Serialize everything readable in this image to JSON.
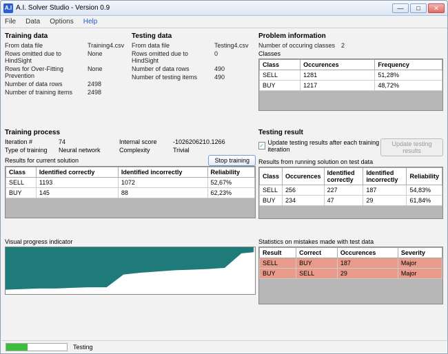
{
  "window": {
    "title": "A.I. Solver Studio - Version 0.9"
  },
  "menu": {
    "file": "File",
    "data": "Data",
    "options": "Options",
    "help": "Help"
  },
  "training_data": {
    "title": "Training data",
    "rows": [
      {
        "k": "From data file",
        "v": "Training4.csv"
      },
      {
        "k": "Rows omitted due to HindSight",
        "v": "None"
      },
      {
        "k": "Rows for Over-Fitting Prevention",
        "v": "None"
      },
      {
        "k": "Number of data rows",
        "v": "2498"
      },
      {
        "k": "Number of training items",
        "v": "2498"
      }
    ]
  },
  "testing_data": {
    "title": "Testing data",
    "rows": [
      {
        "k": "From data file",
        "v": "Testing4.csv"
      },
      {
        "k": "Rows omitted due to HindSight",
        "v": "0"
      },
      {
        "k": "Number of data rows",
        "v": "490"
      },
      {
        "k": "Number of testing items",
        "v": "490"
      }
    ]
  },
  "problem": {
    "title": "Problem information",
    "num_classes_label": "Number of occuring classes",
    "num_classes": "2",
    "classes_label": "Classes",
    "headers": [
      "Class",
      "Occurences",
      "Frequency"
    ],
    "rows": [
      [
        "SELL",
        "1281",
        "51,28%"
      ],
      [
        "BUY",
        "1217",
        "48,72%"
      ]
    ]
  },
  "training_process": {
    "title": "Training process",
    "iteration_label": "Iteration #",
    "iteration": "74",
    "score_label": "Internal score",
    "score": "-1026206210.1266",
    "type_label": "Type of training",
    "type": "Neural network",
    "complexity_label": "Complexity",
    "complexity": "Trivial",
    "results_label": "Results for current solution",
    "stop_btn": "Stop training",
    "headers": [
      "Class",
      "Identified correctly",
      "Identified incorrectly",
      "Reliability"
    ],
    "rows": [
      [
        "SELL",
        "1193",
        "1072",
        "52,67%"
      ],
      [
        "BUY",
        "145",
        "88",
        "62,23%"
      ]
    ]
  },
  "testing_result": {
    "title": "Testing result",
    "update_cb": "Update testing results after each training iteration",
    "update_btn": "Update testing results",
    "results_label": "Results from running solution on test data",
    "headers": [
      "Class",
      "Occurences",
      "Identified correctly",
      "Identified incorrectly",
      "Reliability"
    ],
    "rows": [
      [
        "SELL",
        "256",
        "227",
        "187",
        "54,83%"
      ],
      [
        "BUY",
        "234",
        "47",
        "29",
        "61,84%"
      ]
    ],
    "stats_label": "Statistics on mistakes made with test data",
    "stats_headers": [
      "Result",
      "Correct",
      "Occurences",
      "Severity"
    ],
    "stats_rows": [
      [
        "SELL",
        "BUY",
        "187",
        "Major"
      ],
      [
        "BUY",
        "SELL",
        "29",
        "Major"
      ]
    ]
  },
  "visual": {
    "title": "Visual progress indicator"
  },
  "status": {
    "text": "Testing"
  },
  "chart_data": {
    "type": "line",
    "title": "Visual progress indicator",
    "xlabel": "",
    "ylabel": "",
    "x": [
      0,
      5,
      10,
      15,
      20,
      25,
      30,
      35,
      40,
      45,
      50,
      55,
      60,
      65,
      70,
      74
    ],
    "values": [
      10,
      11,
      12,
      12,
      13,
      14,
      14,
      35,
      38,
      40,
      42,
      43,
      44,
      46,
      70,
      72
    ],
    "ylim": [
      0,
      80
    ]
  }
}
